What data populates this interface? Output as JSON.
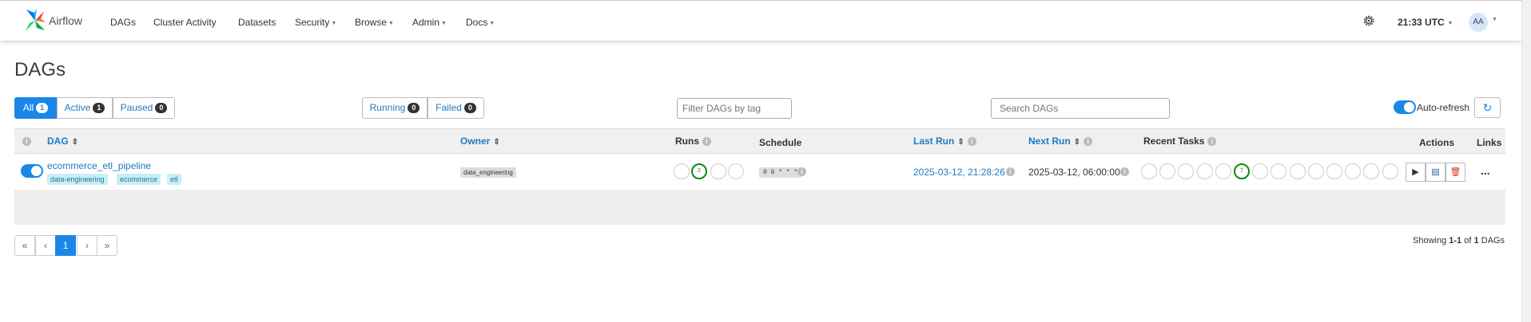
{
  "navbar": {
    "brand": "Airflow",
    "items": [
      {
        "label": "DAGs"
      },
      {
        "label": "Cluster Activity"
      },
      {
        "label": "Datasets"
      },
      {
        "label": "Security"
      },
      {
        "label": "Browse"
      },
      {
        "label": "Admin"
      },
      {
        "label": "Docs"
      }
    ],
    "time": "21:33 UTC",
    "avatar_initials": "AA",
    "icons": {
      "settings": "gear-icon",
      "dropdown": "chevron-down-icon"
    }
  },
  "page": {
    "title": "DAGs"
  },
  "filters": {
    "all": {
      "label": "All",
      "count": "1"
    },
    "active": {
      "label": "Active",
      "count": "1"
    },
    "paused": {
      "label": "Paused",
      "count": "0"
    },
    "running": {
      "label": "Running",
      "count": "0"
    },
    "failed": {
      "label": "Failed",
      "count": "0"
    },
    "tag_placeholder": "Filter DAGs by tag",
    "search_placeholder": "Search DAGs",
    "auto_refresh": "Auto-refresh",
    "refresh_icon": "refresh-icon"
  },
  "table": {
    "headers": {
      "info": "i",
      "dag": "DAG",
      "owner": "Owner",
      "runs": "Runs",
      "schedule": "Schedule",
      "last_run": "Last Run",
      "next_run": "Next Run",
      "recent_tasks": "Recent Tasks",
      "actions": "Actions",
      "links": "Links"
    },
    "rows": [
      {
        "dag_id": "ecommerce_etl_pipeline",
        "tags": [
          "data-engineering",
          "ecommerce",
          "etl"
        ],
        "owner": "data_engineering",
        "runs_success_count": "2",
        "schedule": "0 6 * * *",
        "last_run": "2025-03-12, 21:28:26",
        "next_run": "2025-03-12, 06:00:00",
        "recent_tasks_success_count": "7",
        "actions": {
          "trigger_icon": "play-icon",
          "refresh_icon": "file-refresh-icon",
          "delete_icon": "trash-icon"
        },
        "links": "..."
      }
    ]
  },
  "pagination": {
    "first": "«",
    "prev": "‹",
    "current": "1",
    "next": "›",
    "last": "»",
    "showing_prefix": "Showing ",
    "showing_range": "1-1",
    "showing_of": " of ",
    "showing_total": "1",
    "showing_suffix": " DAGs"
  },
  "colors": {
    "primary": "#1a86e8",
    "success": "#118a11",
    "link": "#217ac0",
    "tag_bg": "#c7eff4"
  }
}
